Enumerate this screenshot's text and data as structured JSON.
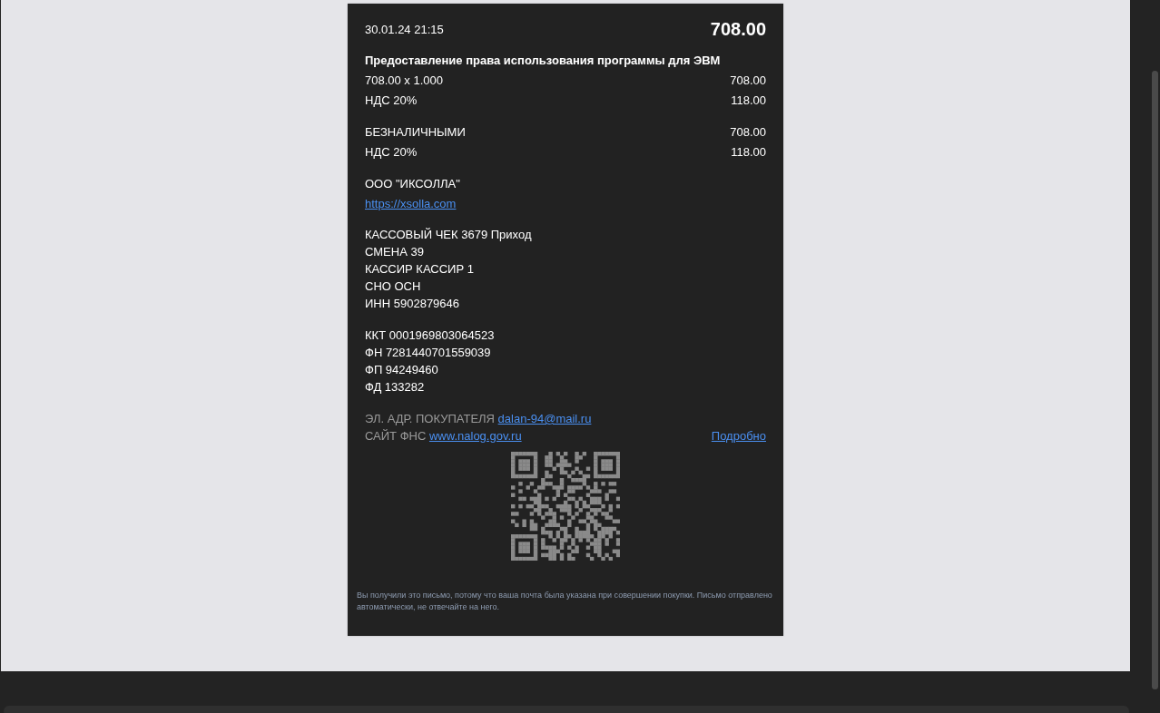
{
  "receipt": {
    "datetime": "30.01.24 21:15",
    "total": "708.00",
    "item_name": "Предоставление права использования программы для ЭВМ",
    "item_rows": [
      {
        "label": "708.00 x 1.000",
        "value": "708.00"
      },
      {
        "label": "НДС 20%",
        "value": "118.00"
      }
    ],
    "payment_rows": [
      {
        "label": "БЕЗНАЛИЧНЫМИ",
        "value": "708.00"
      },
      {
        "label": "НДС 20%",
        "value": "118.00"
      }
    ],
    "seller": "ООО \"ИКСОЛЛА\"",
    "seller_site": "https://xsolla.com",
    "details": [
      "КАССОВЫЙ ЧЕК 3679 Приход",
      "СМЕНА 39",
      "КАССИР КАССИР 1",
      "СНО ОСН",
      "ИНН 5902879646"
    ],
    "fiscal": [
      "ККТ 0001969803064523",
      "ФН 7281440701559039",
      "ФП 94249460",
      "ФД 133282"
    ],
    "buyer_email": {
      "label": "ЭЛ. АДР. ПОКУПАТЕЛЯ",
      "link": "dalan-94@mail.ru"
    },
    "fns_site": {
      "label": "САЙТ ФНС",
      "link": "www.nalog.gov.ru"
    },
    "details_link": "Подробно",
    "footer_note": "Вы получили это письмо, потому что ваша почта была указана при совершении покупки. Письмо отправлено автоматически, не отвечайте на него."
  }
}
